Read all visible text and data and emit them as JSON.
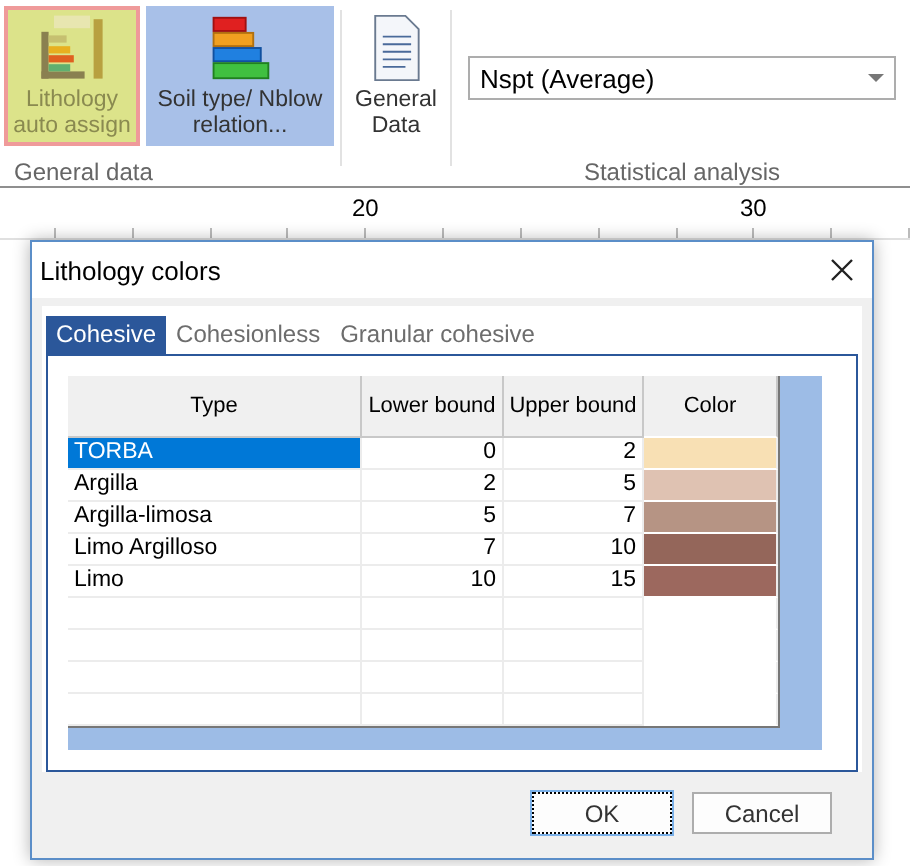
{
  "ribbon": {
    "groups": [
      {
        "kind": "buttons",
        "label": "General data",
        "buttons": [
          {
            "label": "Lithology auto assign",
            "pressed": true,
            "hovered": false
          },
          {
            "label": "Soil type/ Nblow relation...",
            "pressed": false,
            "hovered": true
          }
        ]
      },
      {
        "kind": "buttons",
        "buttons": [
          {
            "label": "General Data",
            "pressed": false,
            "hovered": false
          }
        ]
      },
      {
        "kind": "combo",
        "label": "Statistical analysis",
        "value": "Nspt (Average)"
      }
    ]
  },
  "ruler": {
    "labels": [
      "20",
      "30"
    ]
  },
  "dialog": {
    "title": "Lithology colors",
    "tabs": [
      {
        "label": "Cohesive",
        "selected": true
      },
      {
        "label": "Cohesionless",
        "selected": false
      },
      {
        "label": "Granular cohesive",
        "selected": false
      }
    ],
    "table": {
      "columns": [
        "Type",
        "Lower bound",
        "Upper bound",
        "Color"
      ],
      "rows": [
        {
          "type": "TORBA",
          "lower": "0",
          "upper": "2",
          "color": "#f8e0b4",
          "selected": true
        },
        {
          "type": "Argilla",
          "lower": "2",
          "upper": "5",
          "color": "#dfc2b2",
          "selected": false
        },
        {
          "type": "Argilla-limosa",
          "lower": "5",
          "upper": "7",
          "color": "#b69484",
          "selected": false
        },
        {
          "type": "Limo Argilloso",
          "lower": "7",
          "upper": "10",
          "color": "#94665a",
          "selected": false
        },
        {
          "type": "Limo",
          "lower": "10",
          "upper": "15",
          "color": "#9c685e",
          "selected": false
        }
      ]
    },
    "buttons": [
      {
        "label": "OK",
        "default": true
      },
      {
        "label": "Cancel",
        "default": false
      }
    ]
  }
}
